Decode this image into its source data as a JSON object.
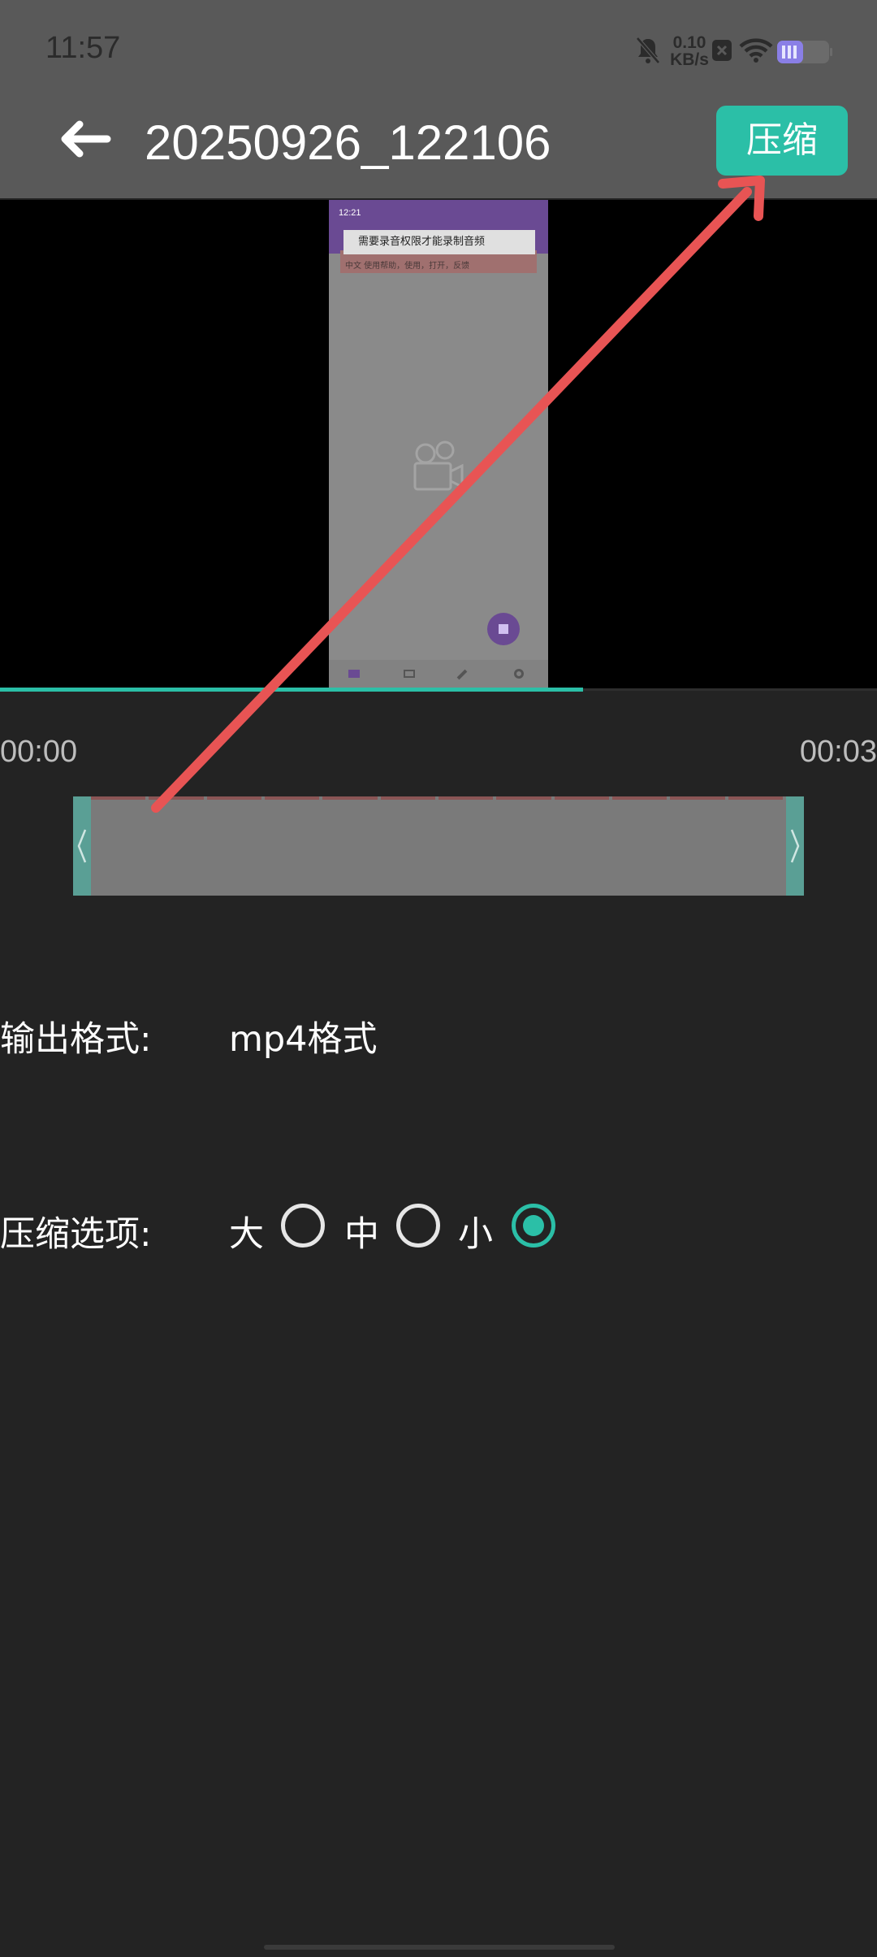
{
  "status_bar": {
    "time": "11:57",
    "net_speed_value": "0.10",
    "net_speed_unit": "KB/s",
    "icons": [
      "bell-muted-icon",
      "x-badge-icon",
      "wifi-icon",
      "battery-icon"
    ]
  },
  "app_bar": {
    "back_icon": "arrow-left-icon",
    "title": "20250926_122106",
    "compress_label": "压缩"
  },
  "preview": {
    "thumb_time": "12:21",
    "dialog_text": "需要录音权限才能录制音频",
    "banner_text": "中文 使用帮助，使用，打开，反馈",
    "tab_icons": [
      "video-icon",
      "image-icon",
      "pencil-icon",
      "gear-icon"
    ],
    "progress_fraction": 0.665
  },
  "timeline": {
    "start_time": "00:00",
    "end_time": "00:03",
    "frame_count": 12
  },
  "output_format": {
    "label": "输出格式:",
    "value": "mp4格式"
  },
  "compression": {
    "label": "压缩选项:",
    "options": [
      {
        "label": "大",
        "selected": false
      },
      {
        "label": "中",
        "selected": false
      },
      {
        "label": "小",
        "selected": true
      }
    ]
  },
  "colors": {
    "accent": "#2bbfa7",
    "annotation_arrow": "#e85454",
    "bar_background": "#595959",
    "page_background": "#232323"
  }
}
